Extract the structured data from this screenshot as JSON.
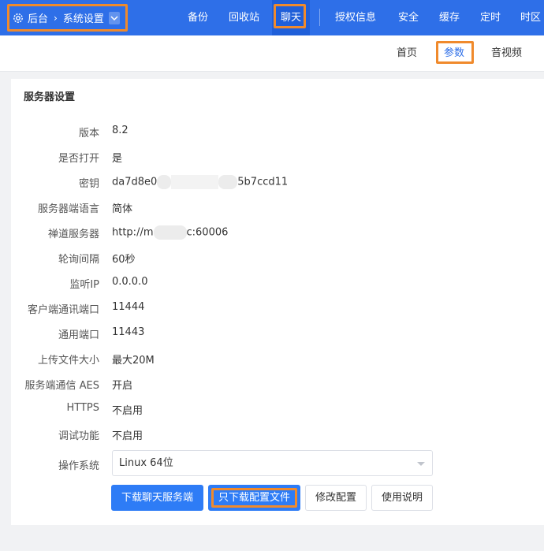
{
  "breadcrumb": {
    "root": "后台",
    "separator": "›",
    "current": "系统设置"
  },
  "top_nav": {
    "items": [
      "备份",
      "回收站",
      "聊天",
      "授权信息",
      "安全",
      "缓存",
      "定时",
      "时区"
    ],
    "active": "聊天"
  },
  "sub_nav": {
    "items": [
      "首页",
      "参数",
      "音视频"
    ],
    "active": "参数"
  },
  "panel": {
    "title": "服务器设置",
    "fields": [
      {
        "label": "版本",
        "value": "8.2"
      },
      {
        "label": "是否打开",
        "value": "是"
      },
      {
        "label": "密钥",
        "value_start": "da7d8e0",
        "value_end": "5b7ccd11"
      },
      {
        "label": "服务器端语言",
        "value": "简体"
      },
      {
        "label": "禅道服务器",
        "value_start": "http://m",
        "value_end": "c:60006"
      },
      {
        "label": "轮询间隔",
        "value": "60秒"
      },
      {
        "label": "监听IP",
        "value": "0.0.0.0"
      },
      {
        "label": "客户端通讯端口",
        "value": "11444"
      },
      {
        "label": "通用端口",
        "value": "11443"
      },
      {
        "label": "上传文件大小",
        "value": "最大20M"
      },
      {
        "label": "服务端通信 AES",
        "value": "开启"
      },
      {
        "label": "HTTPS",
        "value": "不启用"
      },
      {
        "label": "调试功能",
        "value": "不启用"
      }
    ],
    "os_label": "操作系统",
    "os_value": "Linux 64位",
    "buttons": {
      "download_server": "下载聊天服务端",
      "download_config": "只下载配置文件",
      "edit_config": "修改配置",
      "help": "使用说明"
    }
  },
  "colors": {
    "primary": "#2e6fe8",
    "highlight_border": "#f08a2c",
    "button_primary": "#2e7cf6"
  }
}
